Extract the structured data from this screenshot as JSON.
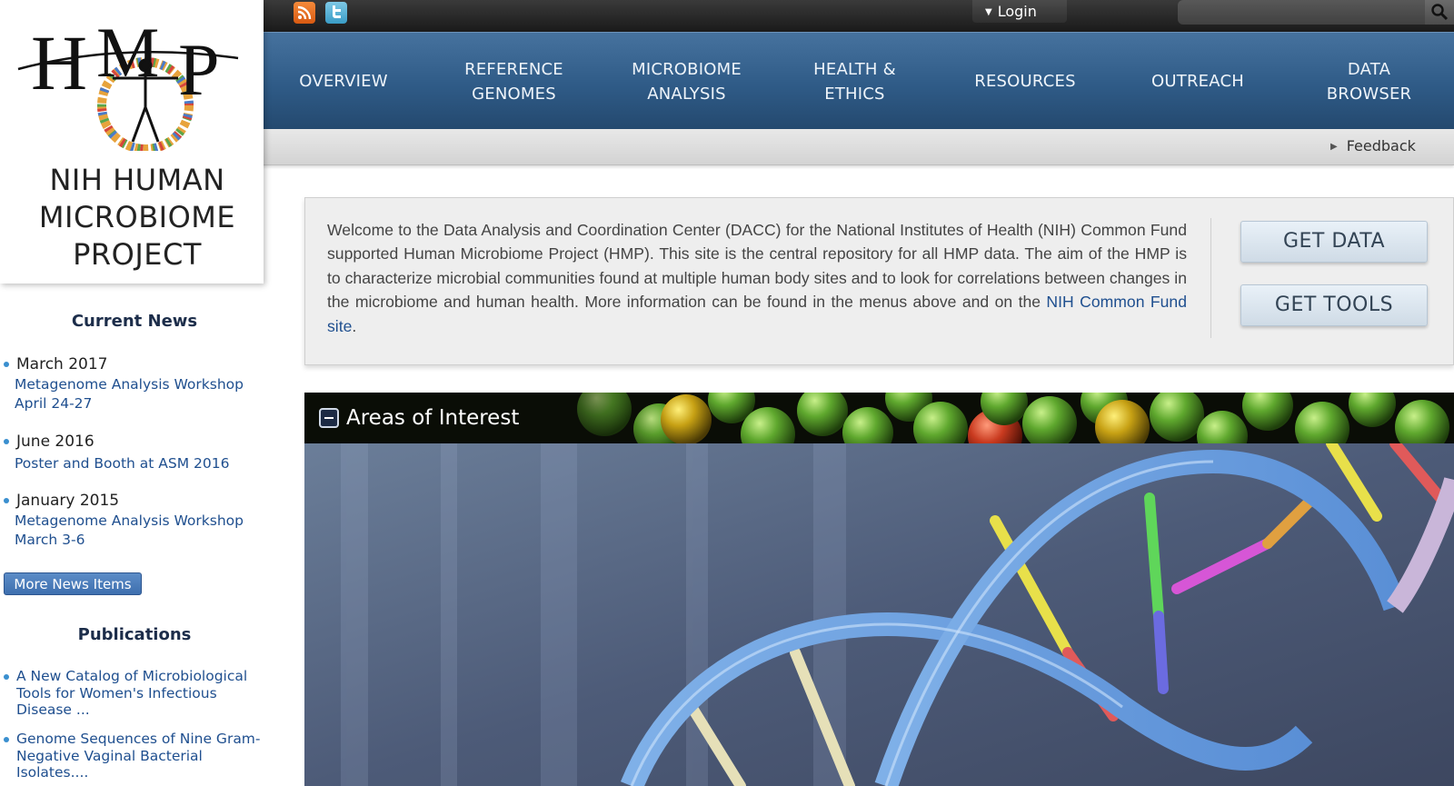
{
  "topbar": {
    "login_label": "Login",
    "search_placeholder": ""
  },
  "nav": {
    "items": [
      {
        "line1": "OVERVIEW",
        "line2": ""
      },
      {
        "line1": "REFERENCE",
        "line2": "GENOMES"
      },
      {
        "line1": "MICROBIOME",
        "line2": "ANALYSIS"
      },
      {
        "line1": "HEALTH &",
        "line2": "ETHICS"
      },
      {
        "line1": "RESOURCES",
        "line2": ""
      },
      {
        "line1": "OUTREACH",
        "line2": ""
      },
      {
        "line1": "DATA",
        "line2": "BROWSER"
      }
    ]
  },
  "strip": {
    "feedback_label": "Feedback"
  },
  "logo": {
    "wordmark": "HMP",
    "title_lines": [
      "NIH HUMAN",
      "MICROBIOME",
      "PROJECT"
    ]
  },
  "news": {
    "heading": "Current News",
    "items": [
      {
        "date": "March 2017",
        "link_lines": [
          "Metagenome Analysis Workshop",
          "April 24-27"
        ]
      },
      {
        "date": "June 2016",
        "link_lines": [
          "Poster and Booth at ASM 2016"
        ]
      },
      {
        "date": "January 2015",
        "link_lines": [
          "Metagenome Analysis Workshop",
          "March 3-6"
        ]
      }
    ],
    "more_label": "More News Items"
  },
  "publications": {
    "heading": "Publications",
    "items": [
      {
        "text": "A New Catalog of Microbiological Tools for Women's Infectious Disease ..."
      },
      {
        "text": "Genome Sequences of Nine Gram-Negative Vaginal Bacterial Isolates...."
      }
    ]
  },
  "welcome": {
    "text": "Welcome to the Data Analysis and Coordination Center (DACC) for the National Institutes of Health (NIH) Common Fund supported Human Microbiome Project (HMP). This site is the central repository for all HMP data. The aim of the HMP is to characterize microbial communities found at multiple human body sites and to look for correlations between changes in the microbiome and human health. More information can be found in the menus above and on the ",
    "link_text": "NIH Common Fund site",
    "suffix": ".",
    "get_data_label": "GET DATA",
    "get_tools_label": "GET TOOLS"
  },
  "areas": {
    "title": "Areas of Interest"
  },
  "icons": {
    "rss": "rss-icon",
    "twitter": "twitter-icon",
    "search": "search-icon",
    "caret": "caret-down-icon",
    "collapse": "collapse-minus-icon",
    "feedback": "triangle-right-icon"
  },
  "colors": {
    "nav_blue": "#2f5b87",
    "link_blue": "#1f4f8f",
    "bullet_blue": "#3a8fcf",
    "button_blue": "#3e6fae"
  }
}
